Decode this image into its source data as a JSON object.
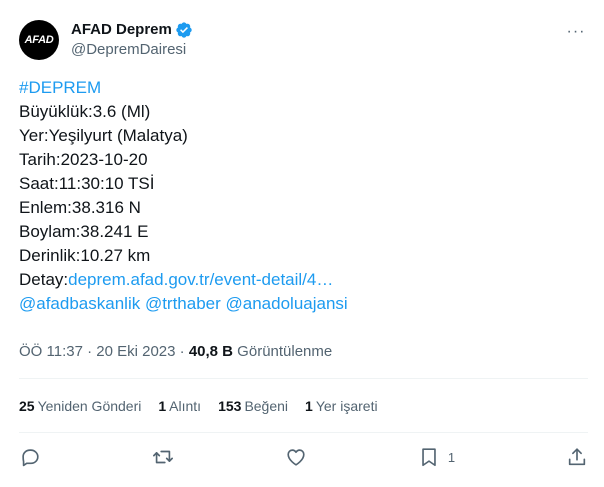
{
  "account": {
    "avatar_text": "AFAD",
    "display_name": "AFAD Deprem",
    "handle": "@DepremDairesi",
    "verified_color": "#1d9bf0"
  },
  "tweet": {
    "hashtag": "#DEPREM",
    "lines": [
      "Büyüklük:3.6 (Ml)",
      "Yer:Yeşilyurt (Malatya)",
      "Tarih:2023-10-20",
      "Saat:11:30:10 TSİ",
      "Enlem:38.316 N",
      "Boylam:38.241 E",
      "Derinlik:10.27 km"
    ],
    "detail_label": "Detay:",
    "detail_link": "deprem.afad.gov.tr/event-detail/4…",
    "mentions": "@afadbaskanlik @trthaber @anadoluajansi"
  },
  "meta": {
    "time_date": "ÖÖ 11:37 · 20 Eki 2023 · ",
    "views_count": "40,8 B",
    "views_label": " Görüntülenme"
  },
  "stats": [
    {
      "count": "25",
      "label": "Yeniden Gönderi"
    },
    {
      "count": "1",
      "label": "Alıntı"
    },
    {
      "count": "153",
      "label": "Beğeni"
    },
    {
      "count": "1",
      "label": "Yer işareti"
    }
  ],
  "actions": {
    "bookmark_count": "1"
  },
  "colors": {
    "link": "#1d9bf0",
    "secondary_text": "#536471",
    "primary_text": "#0f1419"
  }
}
